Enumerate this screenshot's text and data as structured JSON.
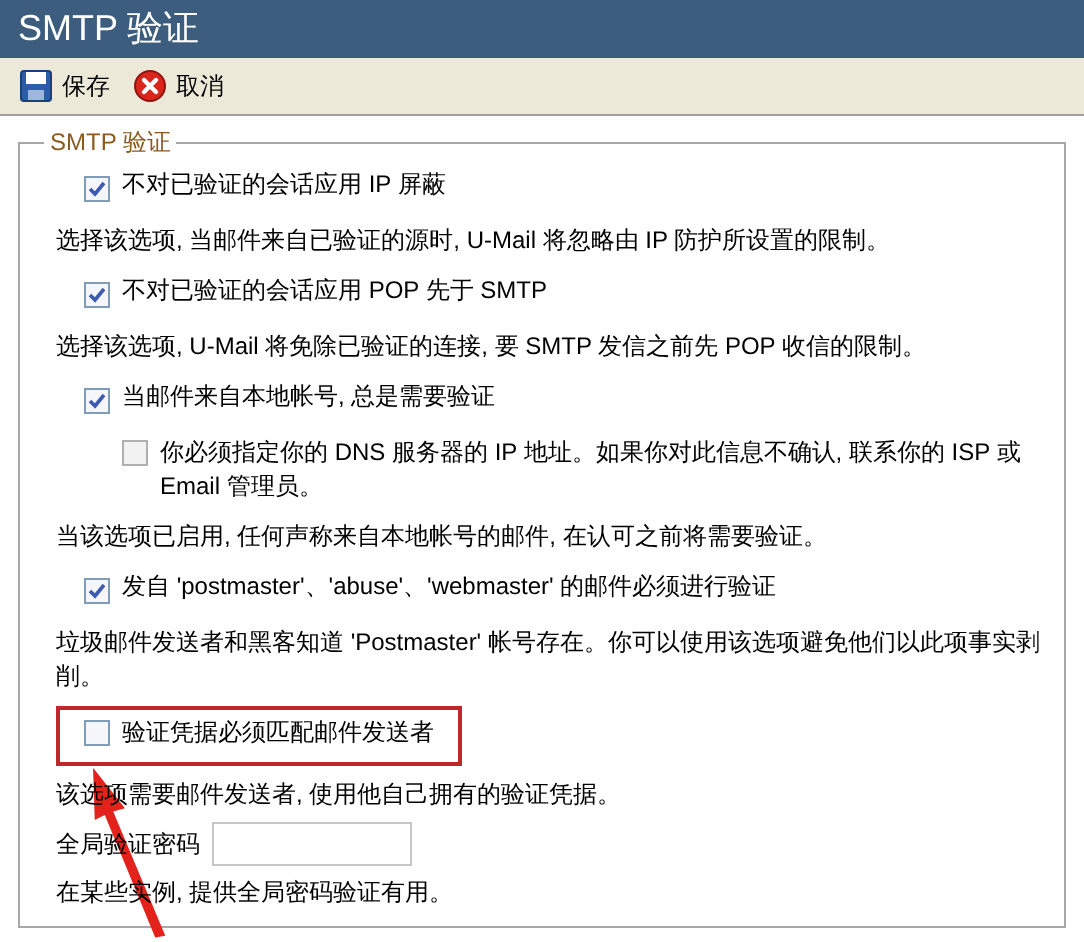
{
  "window": {
    "title": "SMTP 验证"
  },
  "toolbar": [
    {
      "kind": "save",
      "label": "保存"
    },
    {
      "kind": "cancel",
      "label": "取消"
    }
  ],
  "group": {
    "legend": "SMTP 验证",
    "items": [
      {
        "kind": "checkbox",
        "label": "不对已验证的会话应用 IP 屏蔽",
        "checked": true,
        "highlighted": false
      },
      {
        "kind": "text",
        "text": "选择该选项, 当邮件来自已验证的源时, U-Mail 将忽略由 IP 防护所设置的限制。"
      },
      {
        "kind": "checkbox",
        "label": "不对已验证的会话应用 POP 先于 SMTP",
        "checked": true,
        "highlighted": false
      },
      {
        "kind": "text",
        "text": "选择该选项, U-Mail 将免除已验证的连接, 要 SMTP 发信之前先 POP 收信的限制。"
      },
      {
        "kind": "checkbox",
        "label": "当邮件来自本地帐号, 总是需要验证",
        "checked": true,
        "highlighted": false,
        "children": [
          {
            "kind": "checkbox",
            "label": "你必须指定你的 DNS 服务器的 IP 地址。如果你对此信息不确认, 联系你的 ISP 或 Email 管理员。",
            "checked": false,
            "highlighted": false
          }
        ]
      },
      {
        "kind": "text",
        "text": "当该选项已启用, 任何声称来自本地帐号的邮件, 在认可之前将需要验证。"
      },
      {
        "kind": "checkbox",
        "label": "发自 'postmaster'、'abuse'、'webmaster' 的邮件必须进行验证",
        "checked": true,
        "highlighted": false
      },
      {
        "kind": "text",
        "text": "垃圾邮件发送者和黑客知道 'Postmaster' 帐号存在。你可以使用该选项避免他们以此项事实剥削。"
      },
      {
        "kind": "checkbox",
        "label": "验证凭据必须匹配邮件发送者",
        "checked": false,
        "highlighted": true
      },
      {
        "kind": "text",
        "text": "该选项需要邮件发送者, 使用他自己拥有的验证凭据。"
      },
      {
        "kind": "field",
        "label": "全局验证密码"
      },
      {
        "kind": "text",
        "text": "在某些实例, 提供全局密码验证有用。"
      }
    ]
  }
}
